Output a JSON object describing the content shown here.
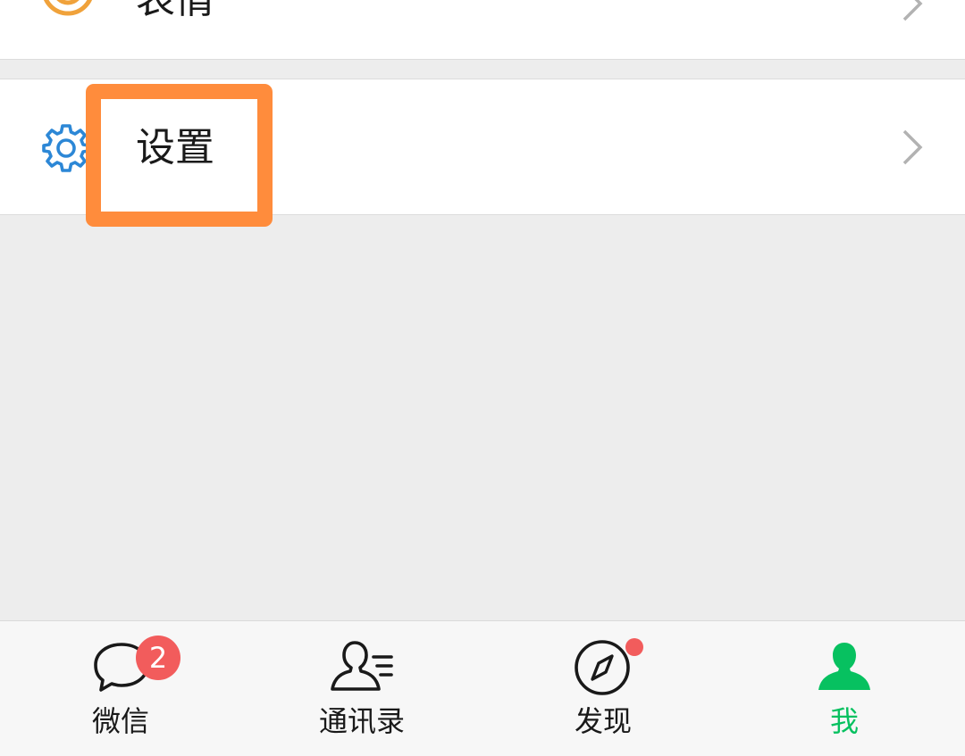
{
  "list": {
    "stickers_label": "表情",
    "settings_label": "设置"
  },
  "tabbar": {
    "tabs": [
      {
        "label": "微信",
        "icon": "chat-bubble-icon",
        "badge": "2"
      },
      {
        "label": "通讯录",
        "icon": "contacts-icon"
      },
      {
        "label": "发现",
        "icon": "compass-icon"
      },
      {
        "label": "我",
        "icon": "person-icon"
      }
    ],
    "active_index": 3
  },
  "colors": {
    "highlight": "#ff8c3c",
    "active_tab": "#07c160",
    "badge": "#f25c5c",
    "settings_icon": "#2c87d6",
    "stickers_icon": "#f0a23b"
  }
}
